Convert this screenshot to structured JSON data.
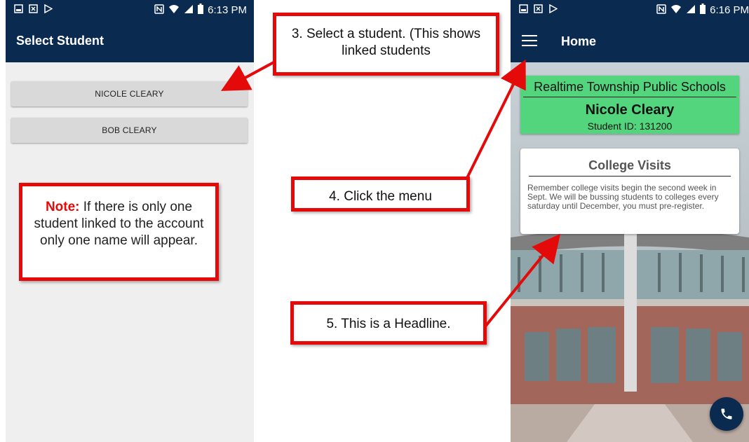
{
  "colors": {
    "navy": "#0b2a4f",
    "red": "#e50a0a",
    "green": "#53d57e",
    "button_gray": "#d9d9d9"
  },
  "select_screen": {
    "status_time": "6:13 PM",
    "title": "Select Student",
    "students": [
      "NICOLE CLEARY",
      "BOB CLEARY"
    ]
  },
  "note": {
    "label": "Note:",
    "text": "If there is only one student linked to the account only one name will appear."
  },
  "callouts": {
    "step3": "3. Select a student. (This shows linked students",
    "step4": "4. Click the menu",
    "step5": "5. This is a Headline."
  },
  "home_screen": {
    "status_time": "6:16 PM",
    "title": "Home",
    "school_name": "Realtime Township Public Schools",
    "student_name": "Nicole Cleary",
    "student_id": "Student ID: 131200",
    "headline": {
      "title": "College Visits",
      "body": "Remember college visits begin the second week in Sept. We will be bussing students to colleges every saturday until December, you must pre-register."
    }
  },
  "icons": {
    "status_left": [
      "image-icon",
      "close-icon",
      "play-store-icon"
    ],
    "status_right": [
      "nfc-icon",
      "wifi-icon",
      "signal-icon",
      "battery-icon"
    ],
    "menu": "hamburger-menu-icon",
    "fab": "phone-icon"
  }
}
